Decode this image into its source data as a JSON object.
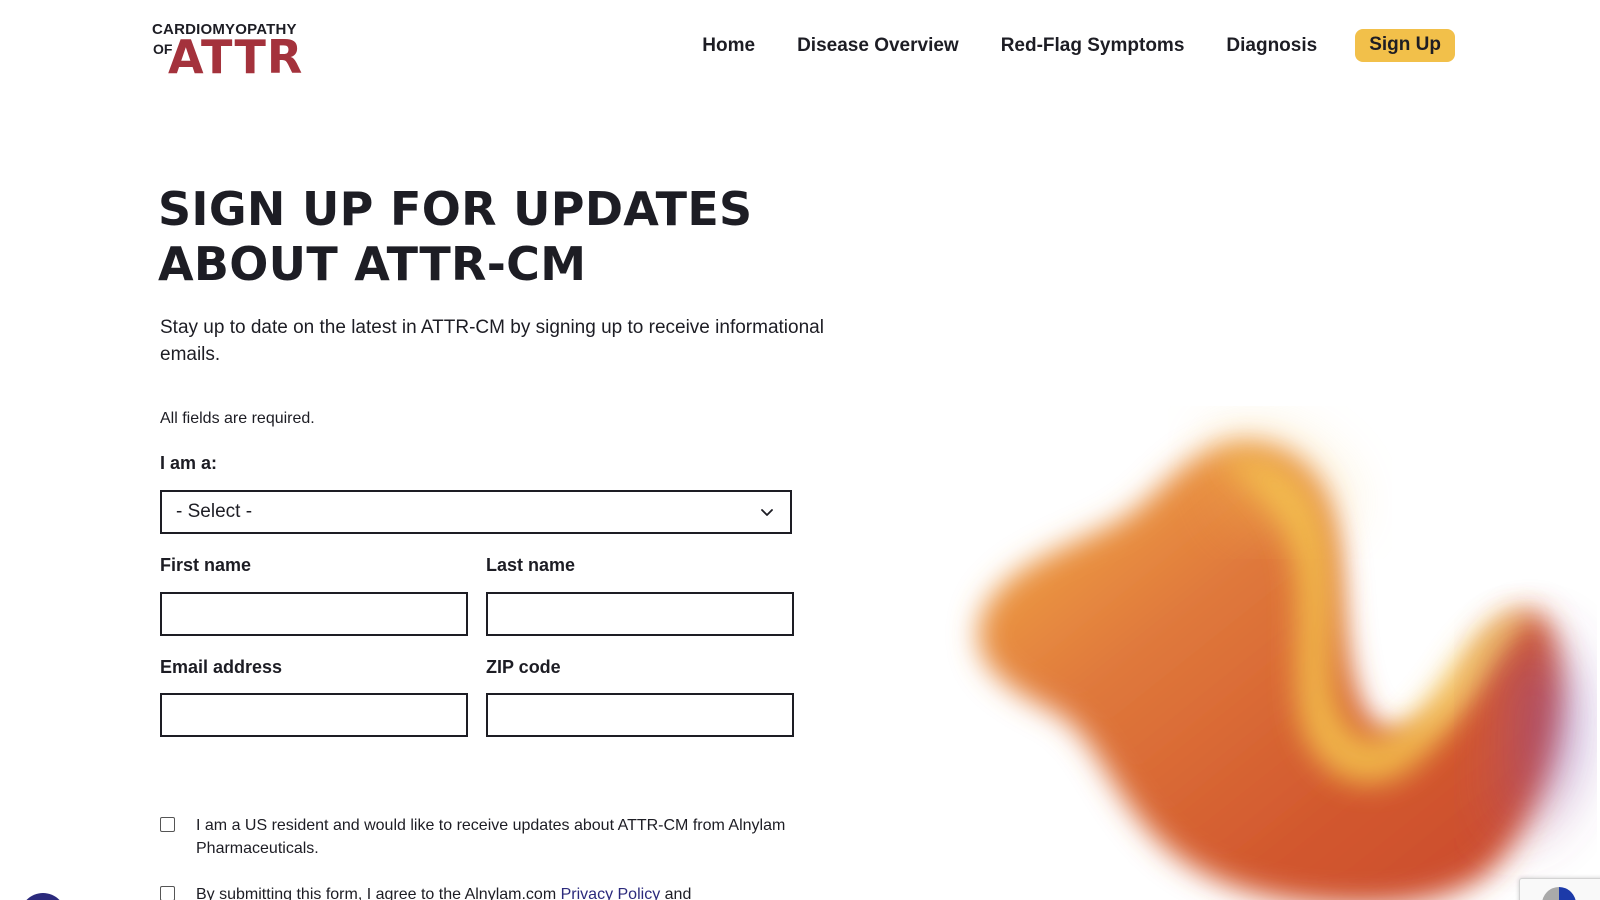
{
  "header": {
    "logo_top": "CARDIOMYOPATHY",
    "logo_of": "OF",
    "logo_main": "ATTR",
    "nav": [
      {
        "label": "Home"
      },
      {
        "label": "Disease Overview"
      },
      {
        "label": "Red-Flag Symptoms"
      },
      {
        "label": "Diagnosis"
      },
      {
        "label": "Sign Up"
      }
    ],
    "accent_color": "#f2c04a",
    "brand_color": "#a4323c"
  },
  "main": {
    "title_line1": "SIGN UP FOR UPDATES",
    "title_line2": "ABOUT ATTR-CM",
    "intro": "Stay up to date on the latest in ATTR-CM by signing up to receive informational emails.",
    "required_note": "All fields are required."
  },
  "form": {
    "role_label": "I am a:",
    "role_value": "- Select -",
    "first_name_label": "First name",
    "first_name_value": "",
    "last_name_label": "Last name",
    "last_name_value": "",
    "email_label": "Email address",
    "email_value": "",
    "zip_label": "ZIP code",
    "zip_value": "",
    "consent_resident": "I am a US resident and would like to receive updates about ATTR-CM from Alnylam Pharmaceuticals.",
    "consent_terms_prefix": "By submitting this form, I agree to the Alnylam.com",
    "consent_terms_link": "Privacy Policy",
    "consent_terms_suffix": "and",
    "link_color": "#2b2a7c"
  },
  "icons": {
    "select_chevron": "chevron-down-icon",
    "logo": "attr-logo",
    "accessibility": "accessibility-icon",
    "recaptcha": "recaptcha-icon"
  }
}
